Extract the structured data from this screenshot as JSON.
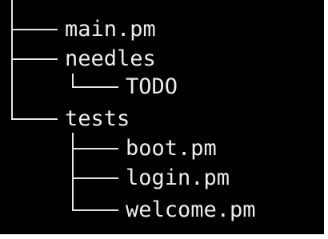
{
  "tree": {
    "root_items": [
      {
        "name": "main.pm"
      },
      {
        "name": "needles",
        "children": [
          {
            "name": "TODO"
          }
        ]
      },
      {
        "name": "tests",
        "children": [
          {
            "name": "boot.pm"
          },
          {
            "name": "login.pm"
          },
          {
            "name": "welcome.pm"
          }
        ]
      }
    ]
  },
  "colors": {
    "background": "#000000",
    "text": "#ededed",
    "tree_lines": "#e6e6e6"
  }
}
